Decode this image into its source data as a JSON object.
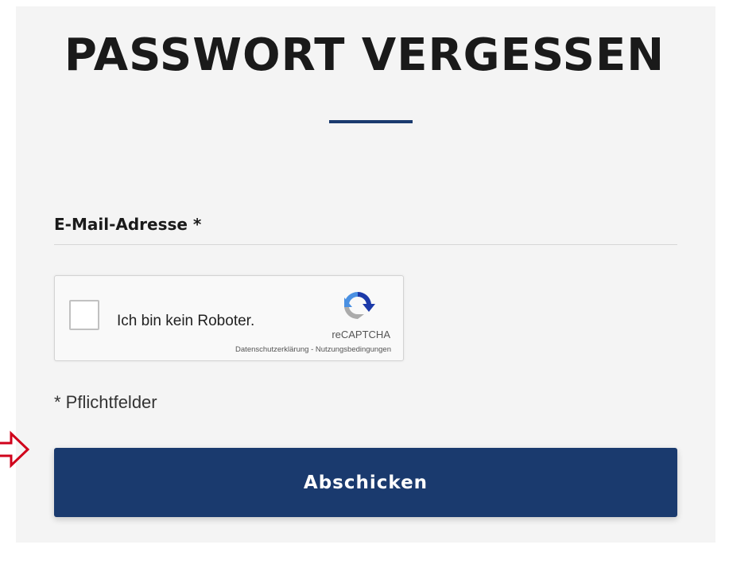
{
  "page": {
    "title": "PASSWORT VERGESSEN"
  },
  "form": {
    "email_label": "E-Mail-Adresse *",
    "email_value": "",
    "required_note": "* Pflichtfelder",
    "submit_label": "Abschicken"
  },
  "captcha": {
    "label": "Ich bin kein Roboter.",
    "brand": "reCAPTCHA",
    "privacy_link": "Datenschutzerklärung",
    "separator": " - ",
    "terms_link": "Nutzungsbedingungen",
    "checked": false,
    "icon": "recaptcha-logo-icon"
  },
  "annotation": {
    "icon": "arrow-right-icon",
    "color": "#d0021b"
  },
  "colors": {
    "accent": "#1a3a6e",
    "panel_background": "#f4f4f4"
  }
}
